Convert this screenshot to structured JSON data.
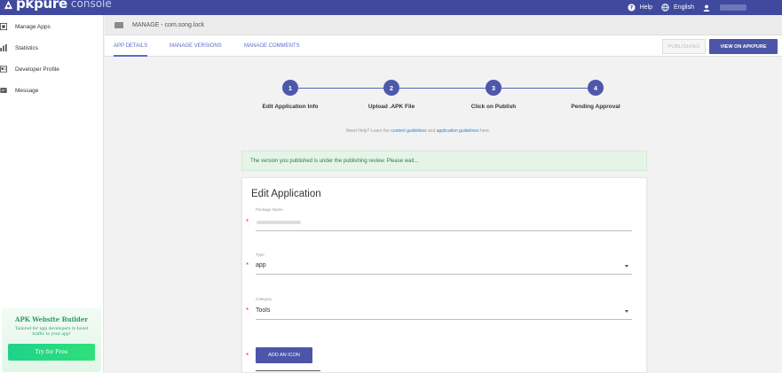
{
  "app": {
    "logo_name": "pkpure",
    "logo_suffix": "console"
  },
  "topbar": {
    "help": "Help",
    "language": "English"
  },
  "sidebar": {
    "items": [
      {
        "label": "Manage Apps",
        "icon": "apps-icon"
      },
      {
        "label": "Statistics",
        "icon": "bar-chart-icon"
      },
      {
        "label": "Developer Profile",
        "icon": "profile-card-icon"
      },
      {
        "label": "Message",
        "icon": "message-icon"
      }
    ],
    "promo": {
      "title": "APK Website Builder",
      "subtitle": "Tailored for app developers to boost traffic to your app!",
      "button": "Try for Free"
    }
  },
  "header": {
    "manage_title": "MANAGE - com.song.lock",
    "tabs": [
      {
        "label": "APP DETAILS",
        "active": true
      },
      {
        "label": "MANAGE VERSIONS",
        "active": false
      },
      {
        "label": "MANAGE COMMENTS",
        "active": false
      }
    ],
    "publishing_label": "PUBLISHING",
    "view_label": "VIEW ON APKPURE"
  },
  "stepper": {
    "steps": [
      {
        "number": "1",
        "label": "Edit Application Info"
      },
      {
        "number": "2",
        "label": "Upload .APK File"
      },
      {
        "number": "3",
        "label": "Click on Publish"
      },
      {
        "number": "4",
        "label": "Pending Approval"
      }
    ],
    "help_prefix": "Need Help? Learn the ",
    "help_link1": "content guidelines",
    "help_mid": " and ",
    "help_link2": "application guidelines",
    "help_suffix": " here."
  },
  "notice": "The version you published is under the publishing review. Please wait...",
  "form": {
    "title": "Edit Application",
    "package_label": "Package Name",
    "type_label": "Type",
    "type_value": "app",
    "category_label": "Category",
    "category_value": "Tools",
    "add_icon_label": "ADD AN ICON"
  },
  "colors": {
    "primary": "#3f4a9e",
    "button": "#4c55a8",
    "link": "#2d7fd8",
    "required": "#e53935",
    "success_bg": "#e4f5e7"
  }
}
